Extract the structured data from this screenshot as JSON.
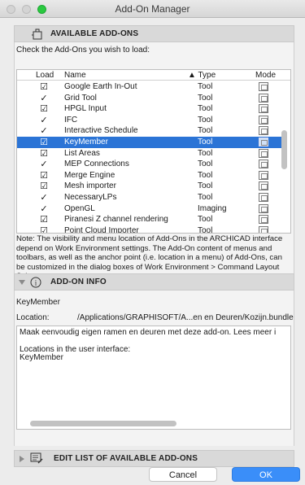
{
  "window": {
    "title": "Add-On Manager"
  },
  "available": {
    "header": "AVAILABLE ADD-ONS",
    "hint": "Check the Add-Ons you wish to load:",
    "columns": {
      "load": "Load",
      "name": "Name",
      "type": "▲ Type",
      "mode": "Mode"
    },
    "rows": [
      {
        "load": "☑",
        "name": "Google Earth In-Out",
        "type": "Tool",
        "selected": false
      },
      {
        "load": "✓",
        "name": "Grid Tool",
        "type": "Tool",
        "selected": false
      },
      {
        "load": "☑",
        "name": "HPGL Input",
        "type": "Tool",
        "selected": false
      },
      {
        "load": "✓",
        "name": "IFC",
        "type": "Tool",
        "selected": false
      },
      {
        "load": "✓",
        "name": "Interactive Schedule",
        "type": "Tool",
        "selected": false
      },
      {
        "load": "☑",
        "name": "KeyMember",
        "type": "Tool",
        "selected": true
      },
      {
        "load": "☑",
        "name": "List Areas",
        "type": "Tool",
        "selected": false
      },
      {
        "load": "✓",
        "name": "MEP Connections",
        "type": "Tool",
        "selected": false
      },
      {
        "load": "☑",
        "name": "Merge Engine",
        "type": "Tool",
        "selected": false
      },
      {
        "load": "☑",
        "name": "Mesh importer",
        "type": "Tool",
        "selected": false
      },
      {
        "load": "✓",
        "name": "NecessaryLPs",
        "type": "Tool",
        "selected": false
      },
      {
        "load": "✓",
        "name": "OpenGL",
        "type": "Imaging",
        "selected": false
      },
      {
        "load": "☑",
        "name": "Piranesi Z channel rendering",
        "type": "Tool",
        "selected": false
      },
      {
        "load": "☑",
        "name": "Point Cloud Importer",
        "type": "Tool",
        "selected": false
      }
    ],
    "note": "Note: The visibility and menu location of Add-Ons in the ARCHICAD interface depend on Work Environment settings. The Add-On content of menus and toolbars, as well as the anchor point (i.e. location in a menu) of Add-Ons, can be customized in the dialog boxes of Work Environment > Command Layout Schemes."
  },
  "info": {
    "header": "ADD-ON INFO",
    "name": "KeyMember",
    "location_label": "Location:",
    "location_path": "/Applications/GRAPHISOFT/A...en en Deuren/Kozijn.bundle",
    "description_lines": [
      "Maak eenvoudig eigen ramen en deuren met deze add-on. Lees meer i",
      "",
      "Locations in the user interface:",
      "KeyMember"
    ]
  },
  "edit_list": {
    "header": "EDIT LIST OF AVAILABLE ADD-ONS"
  },
  "buttons": {
    "cancel": "Cancel",
    "ok": "OK"
  },
  "colors": {
    "selection": "#2b74d6",
    "ok_button": "#3a8ef9",
    "zoom_light": "#2ac940"
  }
}
